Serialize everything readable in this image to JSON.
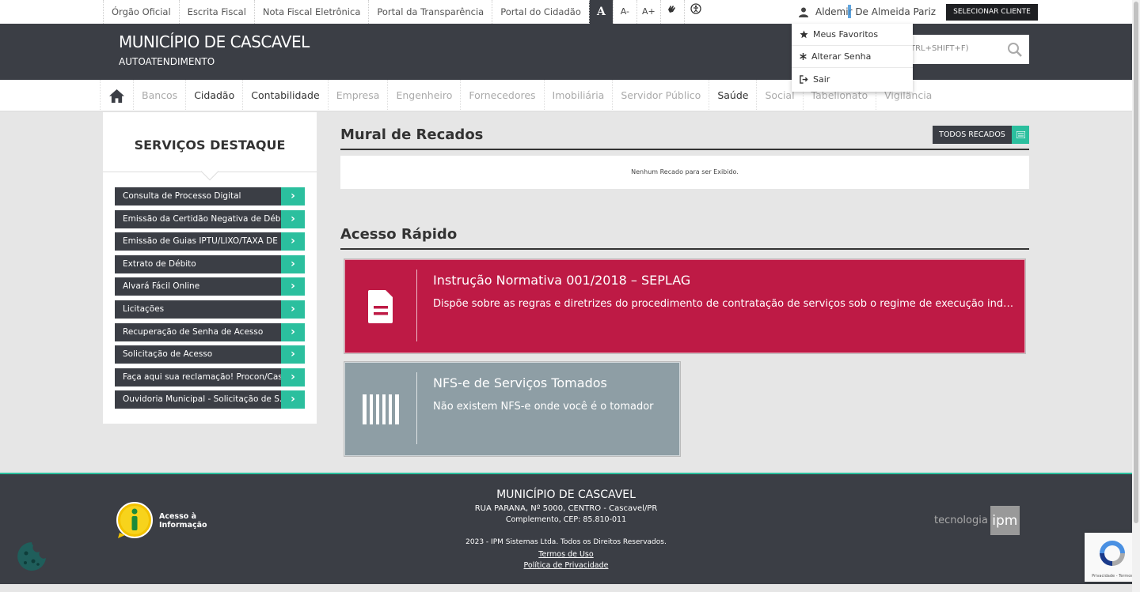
{
  "topbar": {
    "links": [
      "Órgão Oficial",
      "Escrita Fiscal",
      "Nota Fiscal Eletrônica",
      "Portal da Transparência",
      "Portal do Cidadão"
    ],
    "font_buttons": [
      "A",
      "A-",
      "A+"
    ],
    "user_name": "Aldemir De Almeida Pariz",
    "select_client": "SELECIONAR CLIENTE"
  },
  "header": {
    "title": "MUNICÍPIO DE CASCAVEL",
    "subtitle": "AUTOATENDIMENTO",
    "search_hint": "TRL+SHIFT+F)"
  },
  "user_menu": {
    "items": [
      "Meus Favoritos",
      "Alterar Senha",
      "Sair"
    ]
  },
  "nav": {
    "items": [
      {
        "label": "Bancos",
        "active": false
      },
      {
        "label": "Cidadão",
        "active": true
      },
      {
        "label": "Contabilidade",
        "active": true
      },
      {
        "label": "Empresa",
        "active": false
      },
      {
        "label": "Engenheiro",
        "active": false
      },
      {
        "label": "Fornecedores",
        "active": false
      },
      {
        "label": "Imobiliária",
        "active": false
      },
      {
        "label": "Servidor Público",
        "active": false
      },
      {
        "label": "Saúde",
        "active": true
      },
      {
        "label": "Social",
        "active": false
      },
      {
        "label": "Tabelionato",
        "active": false
      },
      {
        "label": "Vigilância",
        "active": false
      }
    ]
  },
  "sidebar": {
    "title": "SERVIÇOS DESTAQUE",
    "items": [
      "Consulta de Processo Digital",
      "Emissão da Certidão Negativa de Débi...",
      "Emissão de Guias IPTU/LIXO/TAXA DE ...",
      "Extrato de Débito",
      "Alvará Fácil Online",
      "Licitações",
      "Recuperação de Senha de Acesso",
      "Solicitação de Acesso",
      "Faça aqui sua reclamação! Procon/Cas...",
      "Ouvidoria Municipal - Solicitação de S..."
    ]
  },
  "mural": {
    "title": "Mural de Recados",
    "all_button": "TODOS RECADOS",
    "empty": "Nenhum Recado para ser Exibido."
  },
  "quick": {
    "title": "Acesso Rápido",
    "cards": [
      {
        "title": "Instrução Normativa 001/2018 – SEPLAG",
        "desc": "Dispõe sobre as regras e diretrizes do procedimento de contratação de serviços sob o regime de execução indireta",
        "color": "#be1a45",
        "icon": "document-icon"
      },
      {
        "title": "NFS-e de Serviços Tomados",
        "desc": "Não existem NFS-e onde você é o tomador",
        "color": "#8e9ea5",
        "icon": "barcode-icon"
      }
    ]
  },
  "footer": {
    "title": "MUNICÍPIO DE CASCAVEL",
    "address": "RUA PARANA, Nº 5000, CENTRO - Cascavel/PR",
    "complement": "Complemento, CEP: 85.810-011",
    "copyright": "2023 - IPM Sistemas Ltda. Todos os Direitos Reservados.",
    "terms": "Termos de Uso",
    "privacy": "Política de Privacidade",
    "access_info": "Acesso à Informação",
    "tech": "tecnologia",
    "tech_brand": "ipm"
  },
  "recaptcha": {
    "text": "Privacidade - Termos"
  }
}
